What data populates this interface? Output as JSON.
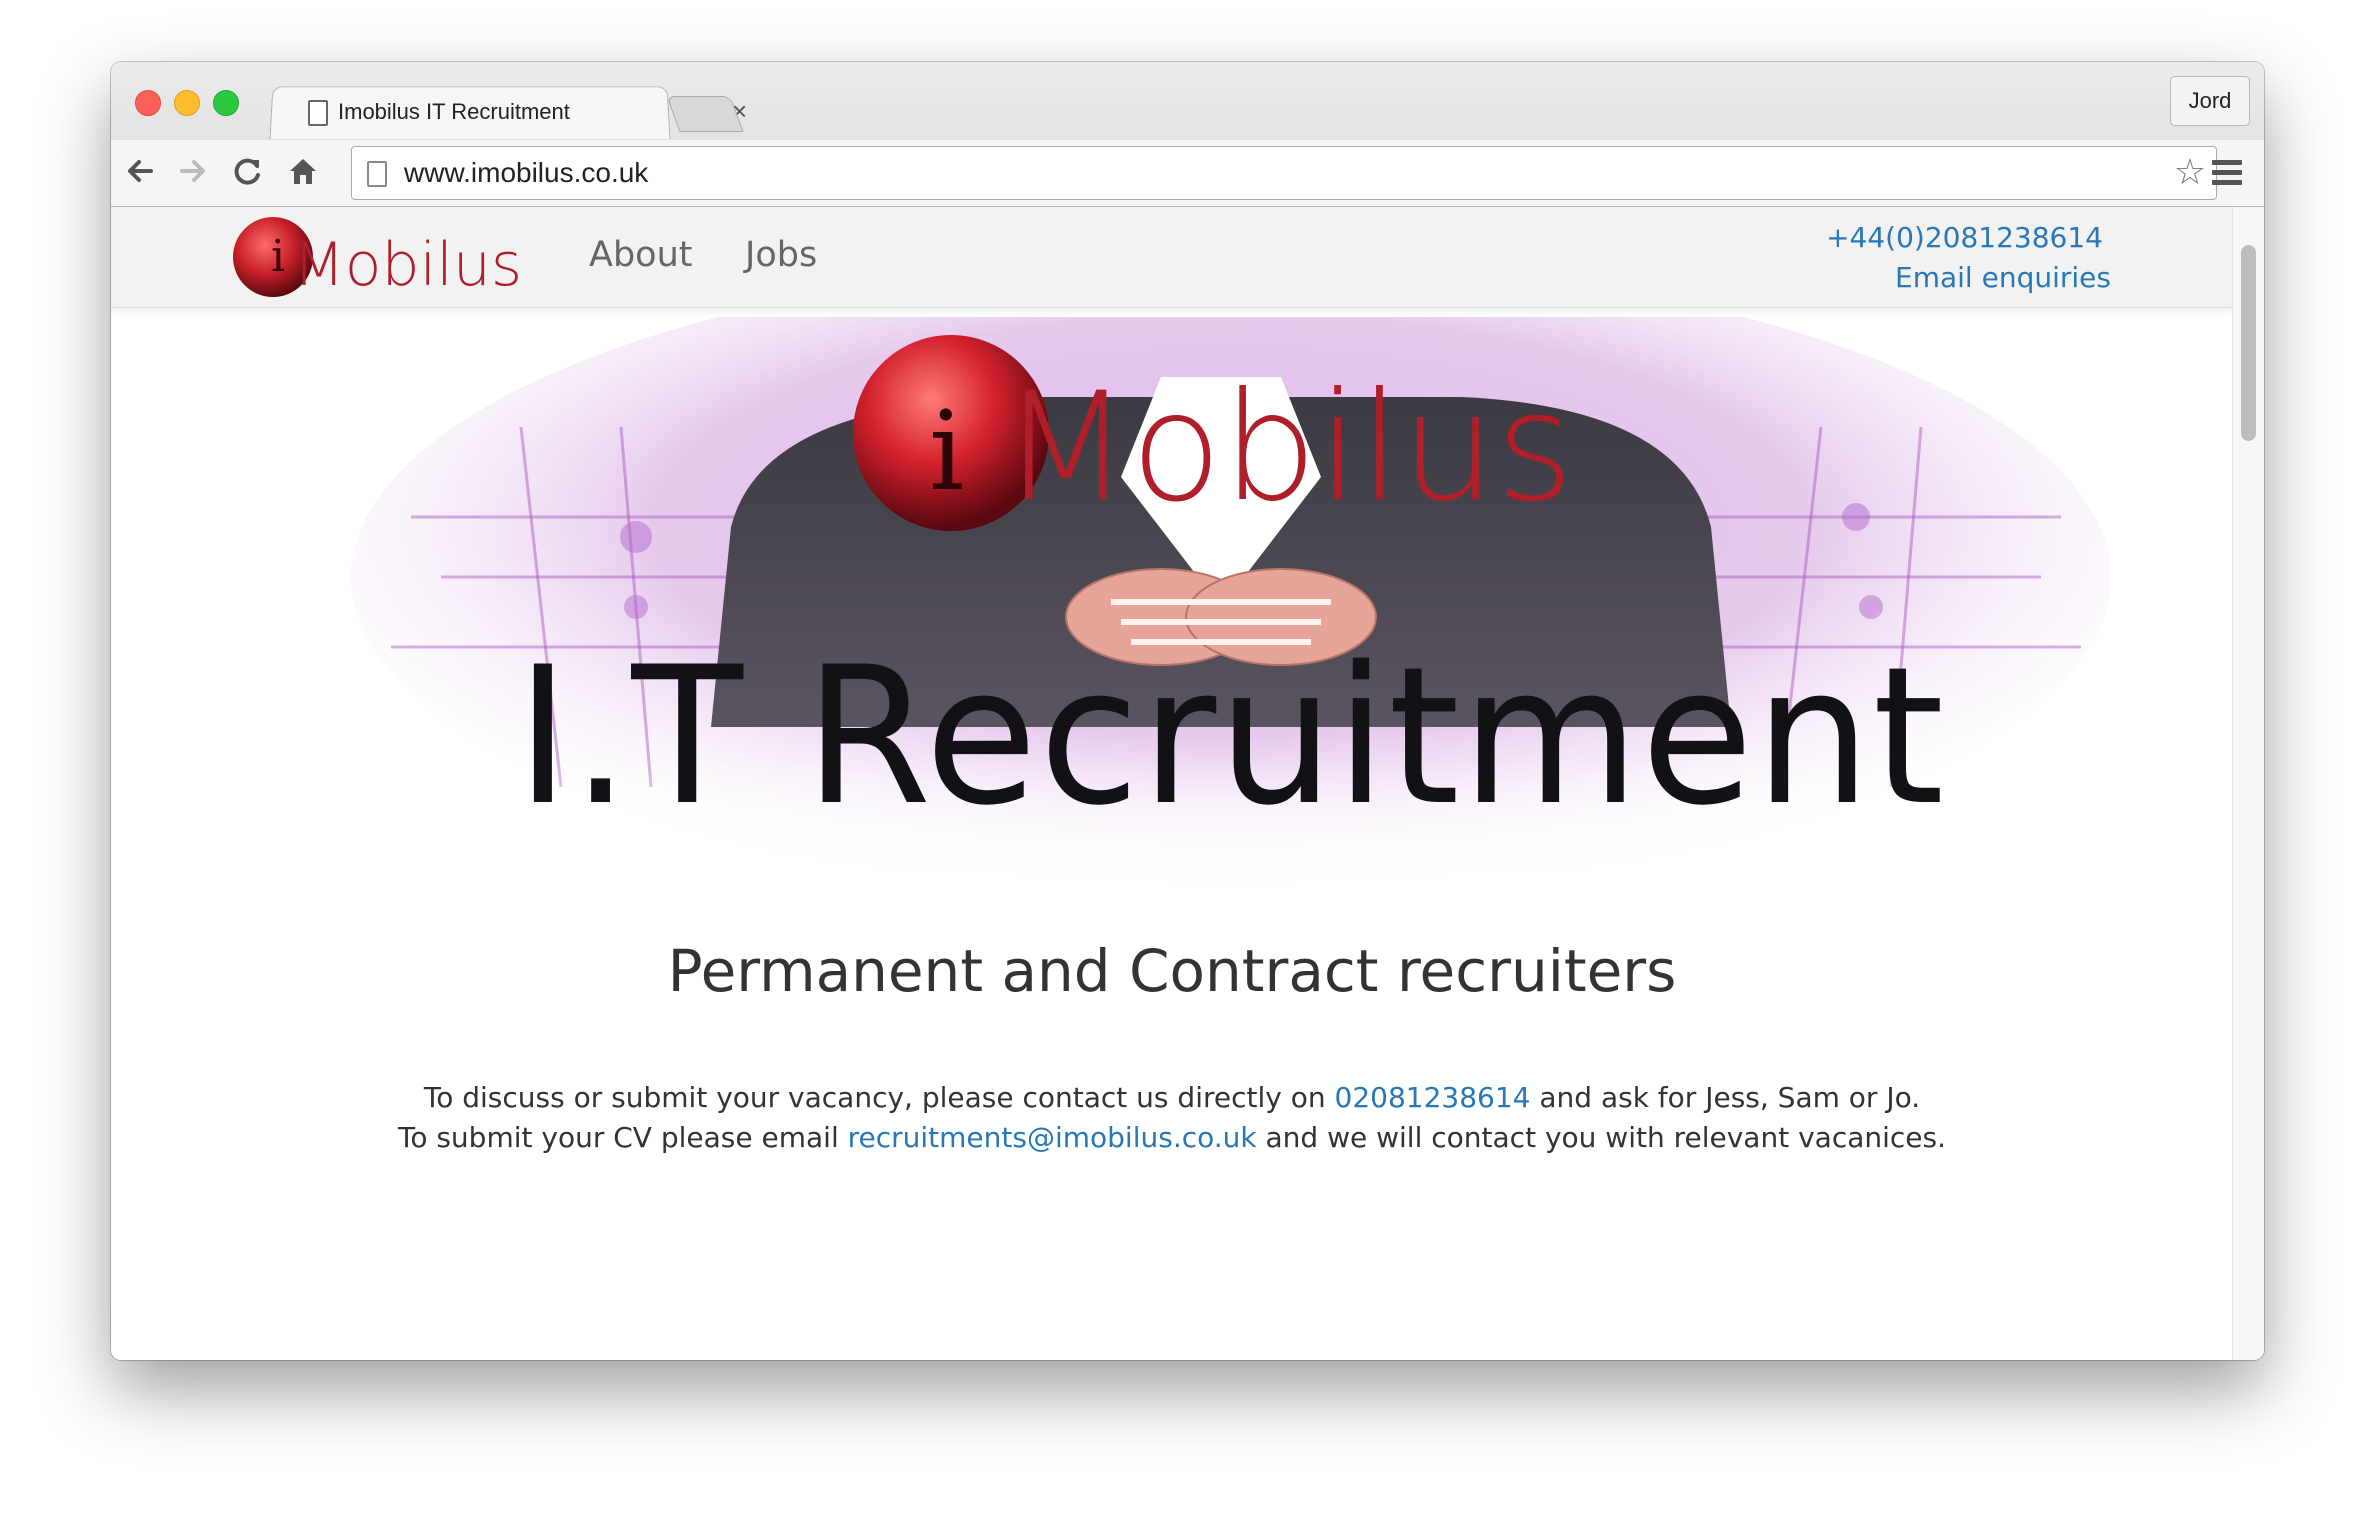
{
  "browser": {
    "tab_title": "Imobilus IT Recruitment",
    "tab_close": "×",
    "profile_label": "Jord",
    "url": "www.imobilus.co.uk",
    "icons": [
      "back-arrow-icon",
      "forward-arrow-icon",
      "reload-icon",
      "home-icon",
      "bookmark-star-icon",
      "menu-icon"
    ]
  },
  "site": {
    "nav": {
      "logo_text": "Mobilus",
      "about": "About",
      "jobs": "Jobs",
      "phone": "+44(0)2081238614",
      "email": "Email enquiries"
    },
    "hero": {
      "logo_text": "Mobilus",
      "banner_text": "I.T Recruitment"
    },
    "headline": "Permanent and Contract recruiters",
    "contact": {
      "line1_a": "To discuss or submit your vacancy, please contact us directly on ",
      "line1_phone": "02081238614",
      "line1_b": " and ask for Jess, Sam or Jo.",
      "line2_a": "To submit your CV please email ",
      "line2_email": "recruitments@imobilus.co.uk",
      "line2_b": " and we will contact you with relevant vacanices."
    }
  },
  "colors": {
    "link": "#2878b8",
    "brand_red": "#c8202a",
    "hero_purple": "#9b3fb0"
  }
}
